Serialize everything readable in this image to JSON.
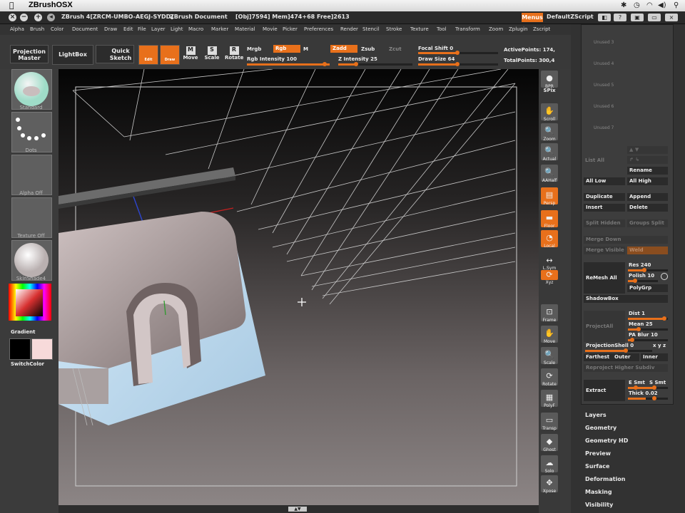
{
  "mac_menubar": {
    "app_name": "ZBrushOSX"
  },
  "title_bar": {
    "title": "ZBrush 4[ZRCM-UMBO-AEGJ-SYDD]",
    "document": "ZBrush Document",
    "stats": "[Obj]7594] Mem]474+68 Free]2613",
    "menus_label": "Menus",
    "script_label": "DefaultZScript"
  },
  "main_menu": [
    "Alpha",
    "Brush",
    "Color",
    "Document",
    "Draw",
    "Edit",
    "File",
    "Layer",
    "Light",
    "Macro",
    "Marker",
    "Material",
    "Movie",
    "Picker",
    "Preferences",
    "Render",
    "Stencil",
    "Stroke",
    "Texture",
    "Tool",
    "Transform",
    "Zoom",
    "Zplugin",
    "Zscript"
  ],
  "shelf": {
    "projection_master": "Projection Master",
    "lightbox": "LightBox",
    "quick_sketch": "Quick Sketch",
    "edit": "Edit",
    "draw": "Draw",
    "move": "Move",
    "scale": "Scale",
    "rotate": "Rotate",
    "mrgb": "Mrgb",
    "rgb": "Rgb",
    "m": "M",
    "zadd": "Zadd",
    "zsub": "Zsub",
    "zcut": "Zcut",
    "rgb_intensity": "Rgb Intensity 100",
    "z_intensity": "Z Intensity 25",
    "focal_shift": "Focal Shift 0",
    "draw_size": "Draw Size 64",
    "active_points": "ActivePoints: 174,",
    "total_points": "TotalPoints: 300,4",
    "rgb_intensity_value": 100,
    "z_intensity_value": 25,
    "draw_size_value": 64
  },
  "left_tray": {
    "brush": "Standard",
    "stroke": "Dots",
    "alpha": "Alpha Off",
    "texture": "Texture Off",
    "material": "SkinShade4",
    "gradient": "Gradient",
    "switch_color": "SwitchColor"
  },
  "right_shelf": [
    {
      "label": "BPR",
      "glyph": "●"
    },
    {
      "label": "SPix",
      "glyph": ""
    },
    {
      "label": "Scroll",
      "glyph": "✋"
    },
    {
      "label": "Zoom",
      "glyph": "🔍"
    },
    {
      "label": "Actual",
      "glyph": "🔍"
    },
    {
      "label": "AAHalf",
      "glyph": "🔍"
    },
    {
      "label": "Persp",
      "glyph": "▤"
    },
    {
      "label": "Floor",
      "glyph": "▬"
    },
    {
      "label": "Local",
      "glyph": "◔"
    },
    {
      "label": "L.Sym",
      "glyph": "↔"
    },
    {
      "label": "Xyz",
      "glyph": "⟳"
    },
    {
      "label": "Frame",
      "glyph": "⊡"
    },
    {
      "label": "Move",
      "glyph": "✋"
    },
    {
      "label": "Scale",
      "glyph": "🔍"
    },
    {
      "label": "Rotate",
      "glyph": "⟳"
    },
    {
      "label": "PolyF",
      "glyph": "▦"
    },
    {
      "label": "Transp",
      "glyph": "▭"
    },
    {
      "label": "Ghost",
      "glyph": "◆"
    },
    {
      "label": "Solo",
      "glyph": "☁"
    },
    {
      "label": "Xpose",
      "glyph": "✥"
    }
  ],
  "subtool_panel": {
    "unused": [
      "Unused 3",
      "Unused 4",
      "Unused 5",
      "Unused 6",
      "Unused 7"
    ],
    "list_all": "List All",
    "rename": "Rename",
    "all_low": "All Low",
    "all_high": "All High",
    "duplicate": "Duplicate",
    "append": "Append",
    "insert": "Insert",
    "delete": "Delete",
    "split_hidden": "Split Hidden",
    "groups_split": "Groups Split",
    "merge_down": "Merge Down",
    "merge_visible": "Merge Visible",
    "weld": "Weld",
    "remesh_all": "ReMesh All",
    "res": "Res 240",
    "polish": "Polish 10",
    "polygrp": "PolyGrp",
    "shadowbox": "ShadowBox",
    "project_all": "ProjectAll",
    "dist": "Dist 1",
    "mean": "Mean 25",
    "pa_blur": "PA Blur 10",
    "projection_shell": "ProjectionShell 0",
    "farthest": "Farthest",
    "outer": "Outer",
    "inner": "Inner",
    "reproject": "Reproject Higher Subdiv",
    "extract": "Extract",
    "e_smt": "E Smt",
    "s_smt": "S Smt",
    "thick": "Thick 0.02"
  },
  "tool_sections": [
    "Layers",
    "Geometry",
    "Geometry HD",
    "Preview",
    "Surface",
    "Deformation",
    "Masking",
    "Visibility"
  ],
  "colors": {
    "accent": "#e8701b",
    "panel": "#3d3d3d",
    "canvas_top": "#0a0a0a",
    "canvas_bottom": "#8a8282"
  }
}
